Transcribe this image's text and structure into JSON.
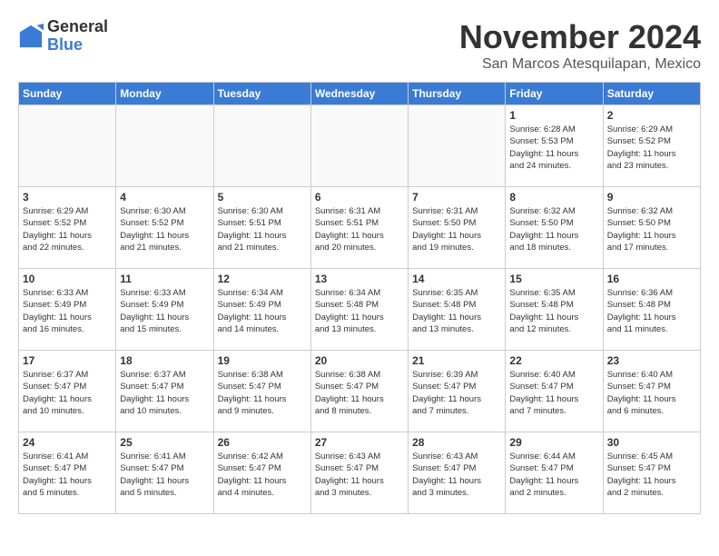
{
  "header": {
    "logo_general": "General",
    "logo_blue": "Blue",
    "month_title": "November 2024",
    "location": "San Marcos Atesquilapan, Mexico"
  },
  "weekdays": [
    "Sunday",
    "Monday",
    "Tuesday",
    "Wednesday",
    "Thursday",
    "Friday",
    "Saturday"
  ],
  "weeks": [
    [
      {
        "day": "",
        "info": ""
      },
      {
        "day": "",
        "info": ""
      },
      {
        "day": "",
        "info": ""
      },
      {
        "day": "",
        "info": ""
      },
      {
        "day": "",
        "info": ""
      },
      {
        "day": "1",
        "info": "Sunrise: 6:28 AM\nSunset: 5:53 PM\nDaylight: 11 hours\nand 24 minutes."
      },
      {
        "day": "2",
        "info": "Sunrise: 6:29 AM\nSunset: 5:52 PM\nDaylight: 11 hours\nand 23 minutes."
      }
    ],
    [
      {
        "day": "3",
        "info": "Sunrise: 6:29 AM\nSunset: 5:52 PM\nDaylight: 11 hours\nand 22 minutes."
      },
      {
        "day": "4",
        "info": "Sunrise: 6:30 AM\nSunset: 5:52 PM\nDaylight: 11 hours\nand 21 minutes."
      },
      {
        "day": "5",
        "info": "Sunrise: 6:30 AM\nSunset: 5:51 PM\nDaylight: 11 hours\nand 21 minutes."
      },
      {
        "day": "6",
        "info": "Sunrise: 6:31 AM\nSunset: 5:51 PM\nDaylight: 11 hours\nand 20 minutes."
      },
      {
        "day": "7",
        "info": "Sunrise: 6:31 AM\nSunset: 5:50 PM\nDaylight: 11 hours\nand 19 minutes."
      },
      {
        "day": "8",
        "info": "Sunrise: 6:32 AM\nSunset: 5:50 PM\nDaylight: 11 hours\nand 18 minutes."
      },
      {
        "day": "9",
        "info": "Sunrise: 6:32 AM\nSunset: 5:50 PM\nDaylight: 11 hours\nand 17 minutes."
      }
    ],
    [
      {
        "day": "10",
        "info": "Sunrise: 6:33 AM\nSunset: 5:49 PM\nDaylight: 11 hours\nand 16 minutes."
      },
      {
        "day": "11",
        "info": "Sunrise: 6:33 AM\nSunset: 5:49 PM\nDaylight: 11 hours\nand 15 minutes."
      },
      {
        "day": "12",
        "info": "Sunrise: 6:34 AM\nSunset: 5:49 PM\nDaylight: 11 hours\nand 14 minutes."
      },
      {
        "day": "13",
        "info": "Sunrise: 6:34 AM\nSunset: 5:48 PM\nDaylight: 11 hours\nand 13 minutes."
      },
      {
        "day": "14",
        "info": "Sunrise: 6:35 AM\nSunset: 5:48 PM\nDaylight: 11 hours\nand 13 minutes."
      },
      {
        "day": "15",
        "info": "Sunrise: 6:35 AM\nSunset: 5:48 PM\nDaylight: 11 hours\nand 12 minutes."
      },
      {
        "day": "16",
        "info": "Sunrise: 6:36 AM\nSunset: 5:48 PM\nDaylight: 11 hours\nand 11 minutes."
      }
    ],
    [
      {
        "day": "17",
        "info": "Sunrise: 6:37 AM\nSunset: 5:47 PM\nDaylight: 11 hours\nand 10 minutes."
      },
      {
        "day": "18",
        "info": "Sunrise: 6:37 AM\nSunset: 5:47 PM\nDaylight: 11 hours\nand 10 minutes."
      },
      {
        "day": "19",
        "info": "Sunrise: 6:38 AM\nSunset: 5:47 PM\nDaylight: 11 hours\nand 9 minutes."
      },
      {
        "day": "20",
        "info": "Sunrise: 6:38 AM\nSunset: 5:47 PM\nDaylight: 11 hours\nand 8 minutes."
      },
      {
        "day": "21",
        "info": "Sunrise: 6:39 AM\nSunset: 5:47 PM\nDaylight: 11 hours\nand 7 minutes."
      },
      {
        "day": "22",
        "info": "Sunrise: 6:40 AM\nSunset: 5:47 PM\nDaylight: 11 hours\nand 7 minutes."
      },
      {
        "day": "23",
        "info": "Sunrise: 6:40 AM\nSunset: 5:47 PM\nDaylight: 11 hours\nand 6 minutes."
      }
    ],
    [
      {
        "day": "24",
        "info": "Sunrise: 6:41 AM\nSunset: 5:47 PM\nDaylight: 11 hours\nand 5 minutes."
      },
      {
        "day": "25",
        "info": "Sunrise: 6:41 AM\nSunset: 5:47 PM\nDaylight: 11 hours\nand 5 minutes."
      },
      {
        "day": "26",
        "info": "Sunrise: 6:42 AM\nSunset: 5:47 PM\nDaylight: 11 hours\nand 4 minutes."
      },
      {
        "day": "27",
        "info": "Sunrise: 6:43 AM\nSunset: 5:47 PM\nDaylight: 11 hours\nand 3 minutes."
      },
      {
        "day": "28",
        "info": "Sunrise: 6:43 AM\nSunset: 5:47 PM\nDaylight: 11 hours\nand 3 minutes."
      },
      {
        "day": "29",
        "info": "Sunrise: 6:44 AM\nSunset: 5:47 PM\nDaylight: 11 hours\nand 2 minutes."
      },
      {
        "day": "30",
        "info": "Sunrise: 6:45 AM\nSunset: 5:47 PM\nDaylight: 11 hours\nand 2 minutes."
      }
    ]
  ]
}
